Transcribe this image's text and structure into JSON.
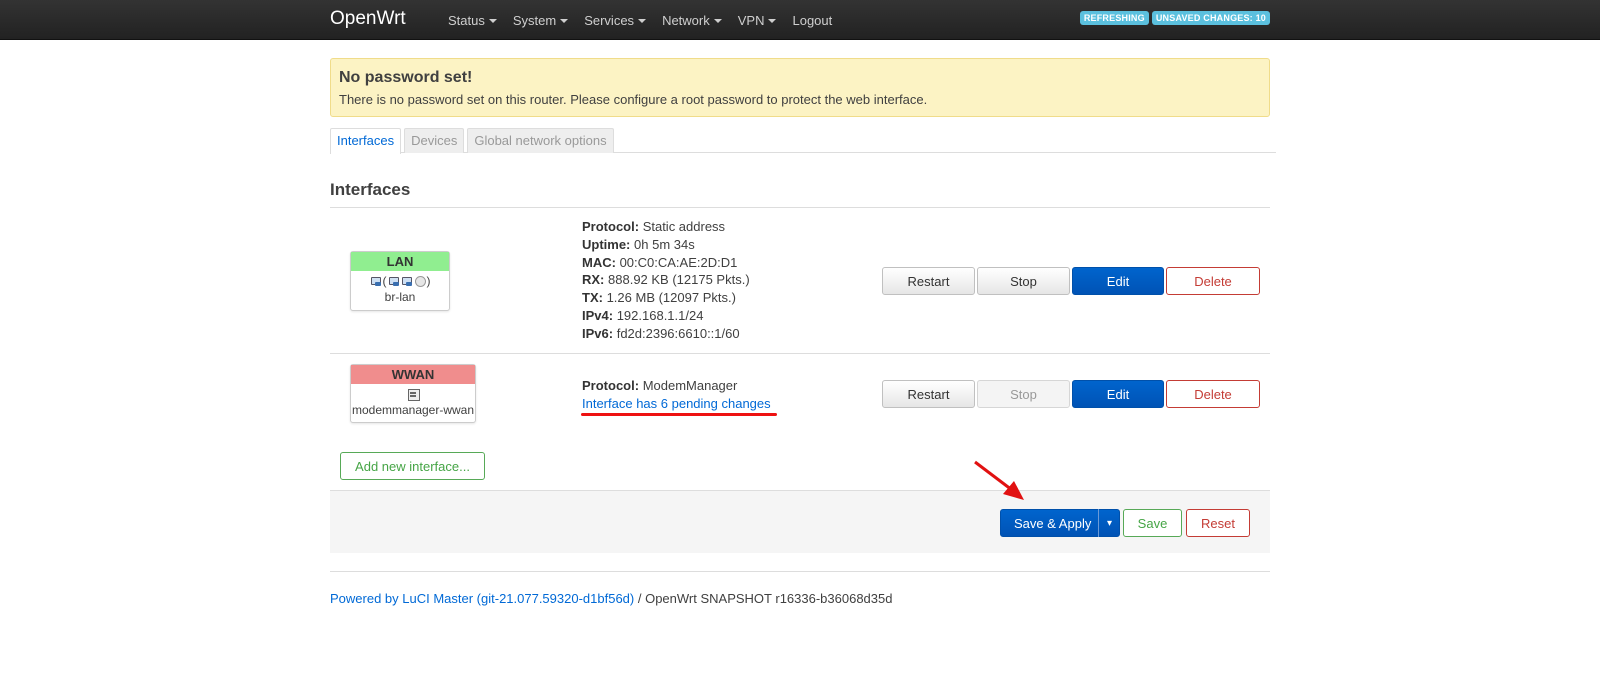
{
  "navbar": {
    "brand": "OpenWrt",
    "menu": [
      {
        "label": "Status",
        "dropdown": true
      },
      {
        "label": "System",
        "dropdown": true
      },
      {
        "label": "Services",
        "dropdown": true
      },
      {
        "label": "Network",
        "dropdown": true
      },
      {
        "label": "VPN",
        "dropdown": true
      },
      {
        "label": "Logout",
        "dropdown": false
      }
    ],
    "badges": [
      "REFRESHING",
      "UNSAVED CHANGES: 10"
    ]
  },
  "alert": {
    "title": "No password set!",
    "message": "There is no password set on this router. Please configure a root password to protect the web interface."
  },
  "tabs": [
    {
      "label": "Interfaces",
      "active": true
    },
    {
      "label": "Devices",
      "active": false
    },
    {
      "label": "Global network options",
      "active": false
    }
  ],
  "section_title": "Interfaces",
  "interfaces": [
    {
      "name": "LAN",
      "head_color": "#90ee90",
      "device": "br-lan",
      "icons": [
        "ethernet-bridge-icon",
        "ethernet-port-icon",
        "ethernet-port-icon",
        "wireless-icon"
      ],
      "details": {
        "protocol_label": "Protocol:",
        "protocol": "Static address",
        "uptime_label": "Uptime:",
        "uptime": "0h 5m 34s",
        "mac_label": "MAC:",
        "mac": "00:C0:CA:AE:2D:D1",
        "rx_label": "RX:",
        "rx": "888.92 KB (12175 Pkts.)",
        "tx_label": "TX:",
        "tx": "1.26 MB (12097 Pkts.)",
        "ipv4_label": "IPv4:",
        "ipv4": "192.168.1.1/24",
        "ipv6_label": "IPv6:",
        "ipv6": "fd2d:2396:6610::1/60"
      },
      "buttons": {
        "restart": "Restart",
        "stop": "Stop",
        "edit": "Edit",
        "delete": "Delete"
      },
      "stop_disabled": false
    },
    {
      "name": "WWAN",
      "head_color": "#f08d8d",
      "device": "modemmanager-wwan",
      "icons": [
        "modem-icon"
      ],
      "details": {
        "protocol_label": "Protocol:",
        "protocol": "ModemManager",
        "pending": "Interface has 6 pending changes"
      },
      "buttons": {
        "restart": "Restart",
        "stop": "Stop",
        "edit": "Edit",
        "delete": "Delete"
      },
      "stop_disabled": true
    }
  ],
  "add_interface": "Add new interface...",
  "actions": {
    "save_apply": "Save & Apply",
    "split_caret": "▾",
    "save": "Save",
    "reset": "Reset"
  },
  "footer": {
    "link": "Powered by LuCI Master (git-21.077.59320-d1bf56d)",
    "text": " / OpenWrt SNAPSHOT r16336-b36068d35d"
  },
  "annotation_color": "#e11111"
}
